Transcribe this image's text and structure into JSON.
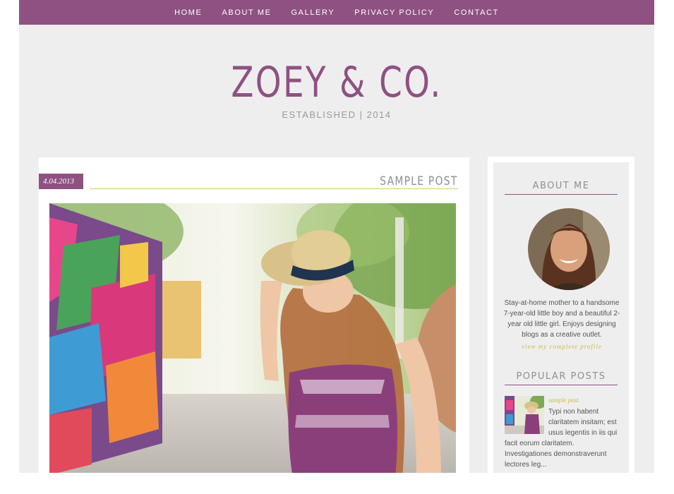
{
  "nav": {
    "items": [
      "HOME",
      "ABOUT ME",
      "GALLERY",
      "PRIVACY POLICY",
      "CONTACT"
    ]
  },
  "header": {
    "title": "ZOEY & CO.",
    "tagline": "ESTABLISHED | 2014"
  },
  "post": {
    "date": "4.04.2013",
    "title": "SAMPLE POST"
  },
  "sidebar": {
    "about": {
      "title": "ABOUT ME",
      "text": "Stay-at-home mother to a handsome 7-year-old little boy and a beautiful 2-year old little girl. Enjoys designing blogs as a creative outlet.",
      "link": "view my complete profile"
    },
    "popular": {
      "title": "POPULAR POSTS",
      "item_title": "sample post",
      "item_excerpt": "Typi non habent claritatem insitam; est usus legentis in iis qui facit eorum claritatem. Investigationes demonstraverunt lectores leg..."
    }
  },
  "colors": {
    "brand": "#8e5182",
    "accent": "#c9b94a",
    "background": "#efeeef"
  }
}
